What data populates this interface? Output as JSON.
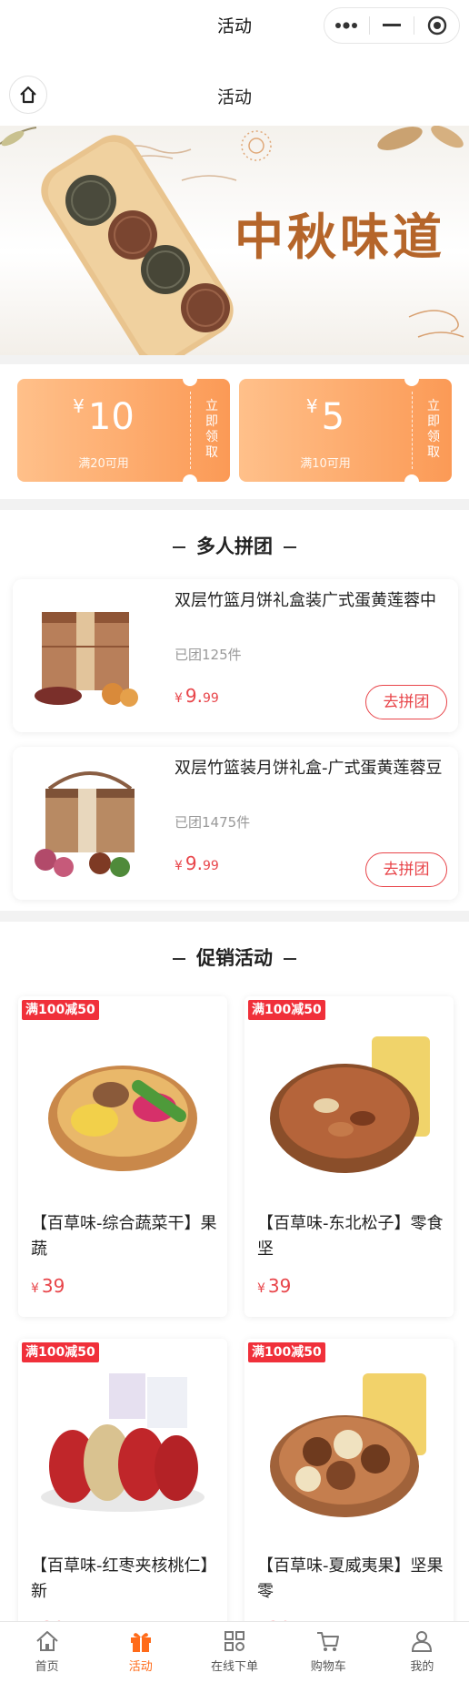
{
  "top_bar": {
    "title": "活动"
  },
  "nav_bar": {
    "title": "活动"
  },
  "banner": {
    "title": "中秋味道"
  },
  "coupons": [
    {
      "currency": "¥",
      "amount": "10",
      "condition": "满20可用",
      "claim": "立即领取"
    },
    {
      "currency": "¥",
      "amount": "5",
      "condition": "满10可用",
      "claim": "立即领取"
    }
  ],
  "group_buy": {
    "title": "多人拼团",
    "items": [
      {
        "name": "双层竹篮月饼礼盒装广式蛋黄莲蓉中",
        "sold": "已团125件",
        "currency": "¥",
        "price_int": "9.",
        "price_dec": "99",
        "button": "去拼团"
      },
      {
        "name": "双层竹篮装月饼礼盒-广式蛋黄莲蓉豆",
        "sold": "已团1475件",
        "currency": "¥",
        "price_int": "9.",
        "price_dec": "99",
        "button": "去拼团"
      }
    ]
  },
  "promotions": {
    "title": "促销活动",
    "items": [
      {
        "tag": "满100减50",
        "name": "【百草味-综合蔬菜干】果蔬",
        "currency": "¥",
        "price": "39"
      },
      {
        "tag": "满100减50",
        "name": "【百草味-东北松子】零食坚",
        "currency": "¥",
        "price": "39"
      },
      {
        "tag": "满100减50",
        "name": "【百草味-红枣夹核桃仁】新",
        "currency": "¥",
        "price": "39"
      },
      {
        "tag": "满100减50",
        "name": "【百草味-夏威夷果】坚果零",
        "currency": "¥",
        "price": "39"
      }
    ]
  },
  "tabbar": {
    "active_color": "#ff6b1a",
    "items": [
      {
        "label": "首页",
        "icon": "home-icon"
      },
      {
        "label": "活动",
        "icon": "gift-icon"
      },
      {
        "label": "在线下单",
        "icon": "grid-icon"
      },
      {
        "label": "购物车",
        "icon": "cart-icon"
      },
      {
        "label": "我的",
        "icon": "user-icon"
      }
    ]
  }
}
